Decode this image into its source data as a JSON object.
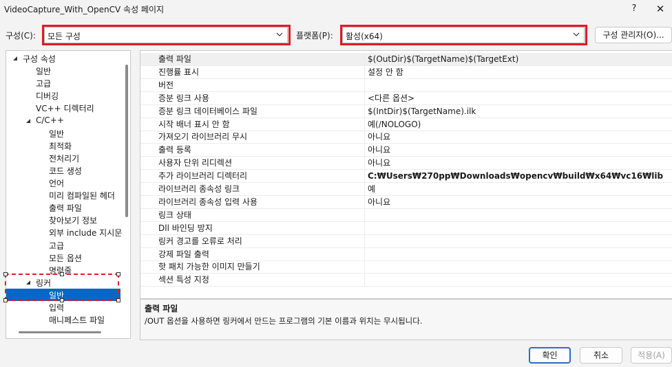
{
  "window": {
    "title": "VideoCapture_With_OpenCV 속성 페이지",
    "help_label": "?",
    "close_label": "✕"
  },
  "toolbar": {
    "config_label": "구성(C):",
    "config_value": "모든 구성",
    "platform_label": "플랫폼(P):",
    "platform_value": "활성(x64)",
    "config_manager_label": "구성 관리자(O)..."
  },
  "tree": {
    "items": [
      {
        "label": "구성 속성",
        "level": 0,
        "expanded": true
      },
      {
        "label": "일반",
        "level": 1
      },
      {
        "label": "고급",
        "level": 1
      },
      {
        "label": "디버깅",
        "level": 1
      },
      {
        "label": "VC++ 디렉터리",
        "level": 1
      },
      {
        "label": "C/C++",
        "level": 1,
        "expanded": true
      },
      {
        "label": "일반",
        "level": 2
      },
      {
        "label": "최적화",
        "level": 2
      },
      {
        "label": "전처리기",
        "level": 2
      },
      {
        "label": "코드 생성",
        "level": 2
      },
      {
        "label": "언어",
        "level": 2
      },
      {
        "label": "미리 컴파일된 헤더",
        "level": 2
      },
      {
        "label": "출력 파일",
        "level": 2
      },
      {
        "label": "찾아보기 정보",
        "level": 2
      },
      {
        "label": "외부 include 지시문",
        "level": 2
      },
      {
        "label": "고급",
        "level": 2
      },
      {
        "label": "모든 옵션",
        "level": 2
      },
      {
        "label": "명령줄",
        "level": 2
      },
      {
        "label": "링커",
        "level": 1,
        "expanded": true
      },
      {
        "label": "일반",
        "level": 2,
        "selected": true
      },
      {
        "label": "입력",
        "level": 2
      },
      {
        "label": "매니페스트 파일",
        "level": 2
      }
    ]
  },
  "grid": {
    "rows": [
      {
        "name": "출력 파일",
        "value": "$(OutDir)$(TargetName)$(TargetExt)",
        "selected": true
      },
      {
        "name": "진행률 표시",
        "value": "설정 안 함"
      },
      {
        "name": "버전",
        "value": ""
      },
      {
        "name": "증분 링크 사용",
        "value": "<다른 옵션>"
      },
      {
        "name": "증분 링크 데이터베이스 파일",
        "value": "$(IntDir)$(TargetName).ilk"
      },
      {
        "name": "시작 배너 표시 안 함",
        "value": "예(/NOLOGO)"
      },
      {
        "name": "가져오기 라이브러리 무시",
        "value": "아니요"
      },
      {
        "name": "출력 등록",
        "value": "아니요"
      },
      {
        "name": "사용자 단위 리디렉션",
        "value": "아니요"
      },
      {
        "name": "추가 라이브러리 디렉터리",
        "value": "C:₩Users₩270pp₩Downloads₩opencv₩build₩x64₩vc16₩lib",
        "bold": true
      },
      {
        "name": "라이브러리 종속성 링크",
        "value": "예"
      },
      {
        "name": "라이브러리 종속성 입력 사용",
        "value": "아니요"
      },
      {
        "name": "링크 상태",
        "value": ""
      },
      {
        "name": "Dll 바인딩 방지",
        "value": ""
      },
      {
        "name": "링커 경고를 오류로 처리",
        "value": ""
      },
      {
        "name": "강제 파일 출력",
        "value": ""
      },
      {
        "name": "핫 패치 가능한 이미지 만들기",
        "value": ""
      },
      {
        "name": "섹션 특성 지정",
        "value": ""
      }
    ]
  },
  "description": {
    "title": "출력 파일",
    "text": "/OUT 옵션을 사용하면 링커에서 만드는 프로그램의 기본 이름과 위치는 무시됩니다."
  },
  "buttons": {
    "ok": "확인",
    "cancel": "취소",
    "apply": "적용(A)"
  },
  "colors": {
    "highlight_red": "#e11b22",
    "selection_blue": "#0667c6"
  }
}
